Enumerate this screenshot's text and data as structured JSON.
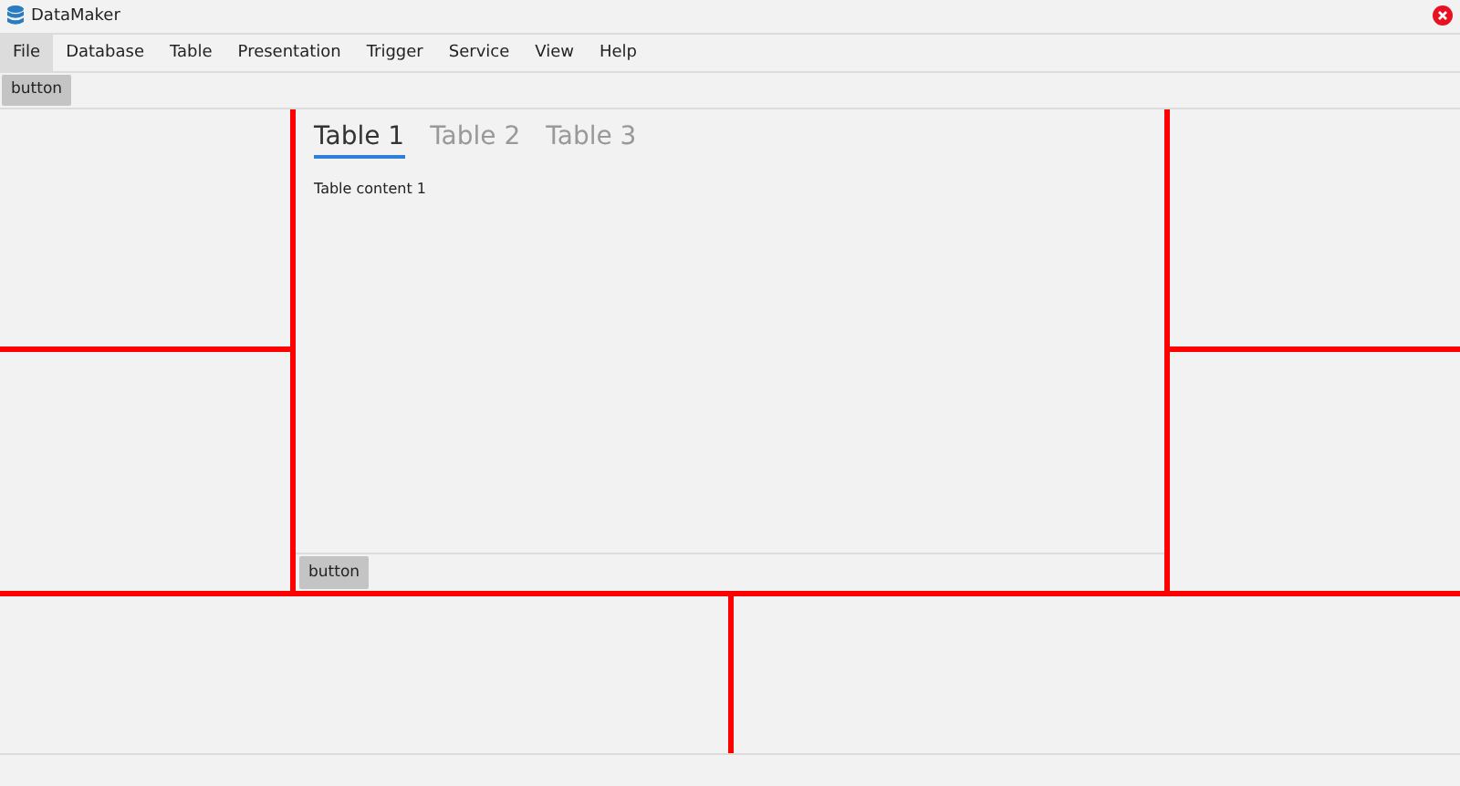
{
  "window": {
    "title": "DataMaker"
  },
  "menu": [
    {
      "label": "File",
      "selected": true
    },
    {
      "label": "Database",
      "selected": false
    },
    {
      "label": "Table",
      "selected": false
    },
    {
      "label": "Presentation",
      "selected": false
    },
    {
      "label": "Trigger",
      "selected": false
    },
    {
      "label": "Service",
      "selected": false
    },
    {
      "label": "View",
      "selected": false
    },
    {
      "label": "Help",
      "selected": false
    }
  ],
  "toolbar": {
    "button": "button"
  },
  "tabs": [
    {
      "label": "Table 1",
      "selected": true
    },
    {
      "label": "Table 2",
      "selected": false
    },
    {
      "label": "Table 3",
      "selected": false
    }
  ],
  "tab_content": "Table content 1",
  "center_toolbar": {
    "button": "button"
  }
}
